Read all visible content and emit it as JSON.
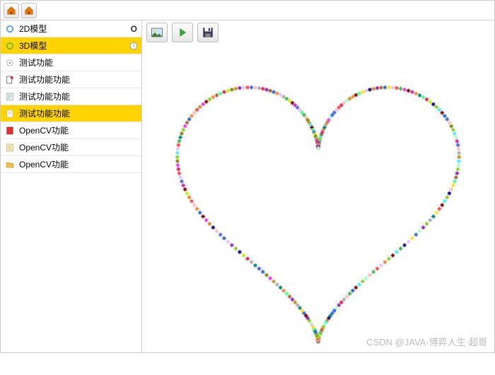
{
  "sidebar": {
    "items": [
      {
        "label": "2D模型",
        "selected": false,
        "right": "O",
        "icon": "gear"
      },
      {
        "label": "3D模型",
        "selected": true,
        "right": "clock",
        "icon": "gear-green"
      },
      {
        "label": "测试功能",
        "selected": false,
        "icon": "radio"
      },
      {
        "label": "测试功能功能",
        "selected": false,
        "icon": "doc"
      },
      {
        "label": "测试功能功能",
        "selected": false,
        "icon": "note"
      },
      {
        "label": "测试功能功能",
        "selected": true,
        "icon": "page"
      },
      {
        "label": "OpenCV功能",
        "selected": false,
        "icon": "book"
      },
      {
        "label": "OpenCV功能",
        "selected": false,
        "icon": "sheet"
      },
      {
        "label": "OpenCV功能",
        "selected": false,
        "icon": "folder"
      }
    ]
  },
  "toolbar": {
    "image_btn": "image",
    "play_btn": "play",
    "save_btn": "save"
  },
  "watermark": "CSDN @JAVA·博弈人生·超哥",
  "chart_data": {
    "type": "scatter",
    "title": "",
    "description": "Heart-shaped parametric curve rendered as multicolored scatter points",
    "xlim": [
      -20,
      20
    ],
    "ylim": [
      -20,
      16
    ],
    "parametric": "x=16*sin(t)^3, y=13*cos(t)-5*cos(2t)-2*cos(3t)-cos(4t)",
    "points_approx": 260,
    "colors": "rainbow-random"
  }
}
